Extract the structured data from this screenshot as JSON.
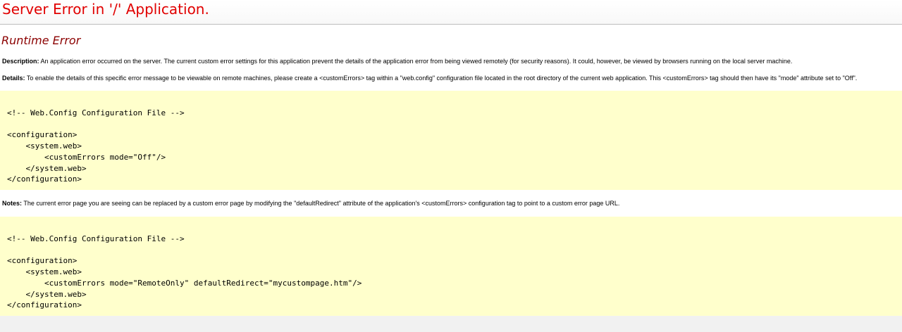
{
  "page": {
    "title": "Server Error in '/' Application.",
    "error_heading": "Runtime Error"
  },
  "description": {
    "label": "Description:",
    "text": " An application error occurred on the server. The current custom error settings for this application prevent the details of the application error from being viewed remotely (for security reasons). It could, however, be viewed by browsers running on the local server machine."
  },
  "details": {
    "label": "Details:",
    "text": " To enable the details of this specific error message to be viewable on remote machines, please create a <customErrors> tag within a \"web.config\" configuration file located in the root directory of the current web application. This <customErrors> tag should then have its \"mode\" attribute set to \"Off\"."
  },
  "code_blocks": [
    {
      "text": "<!-- Web.Config Configuration File -->\n\n<configuration>\n    <system.web>\n        <customErrors mode=\"Off\"/>\n    </system.web>\n</configuration>"
    },
    {
      "text": "<!-- Web.Config Configuration File -->\n\n<configuration>\n    <system.web>\n        <customErrors mode=\"RemoteOnly\" defaultRedirect=\"mycustompage.htm\"/>\n    </system.web>\n</configuration>"
    }
  ],
  "notes": {
    "label": "Notes:",
    "text": " The current error page you are seeing can be replaced by a custom error page by modifying the \"defaultRedirect\" attribute of the application's <customErrors> configuration tag to point to a custom error page URL."
  },
  "colors": {
    "title": "#e10000",
    "heading": "#8b0000",
    "code_background": "#ffffcc",
    "rule": "#bdbdbd"
  }
}
